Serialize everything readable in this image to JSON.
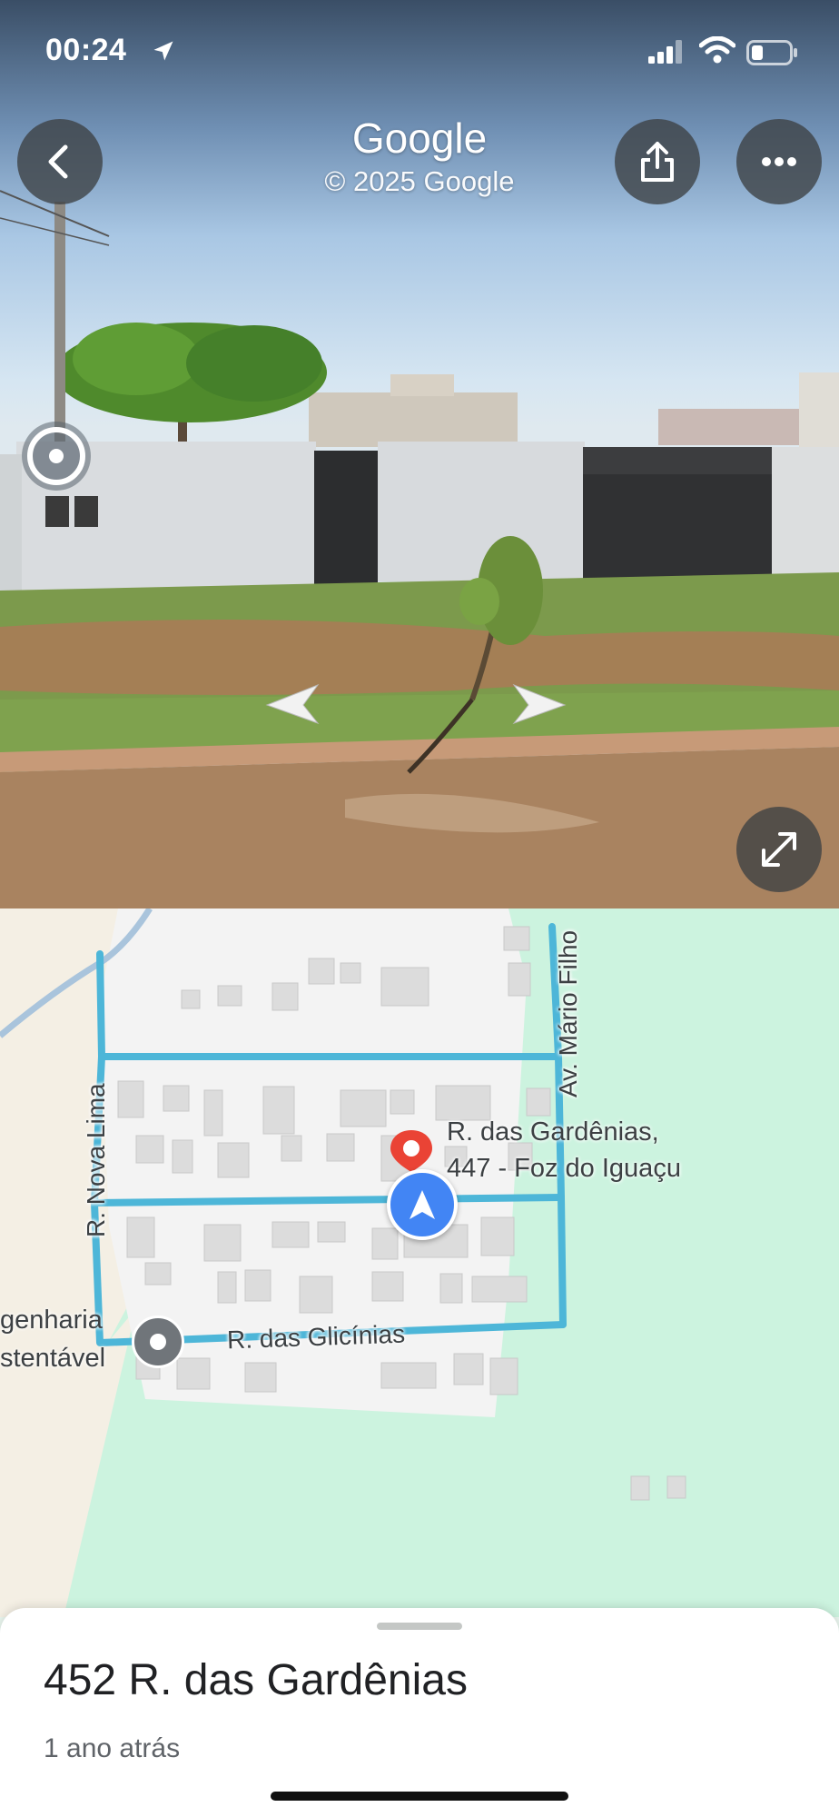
{
  "status_bar": {
    "time": "00:24"
  },
  "panorama": {
    "brand": "Google",
    "copyright": "© 2025 Google",
    "back_icon": "chevron-left-icon",
    "share_icon": "share-icon",
    "more_icon": "more-horizontal-icon",
    "expand_icon": "expand-diagonal-icon"
  },
  "map": {
    "streets": {
      "nova_lima": "R. Nova Lima",
      "mario_filho": "Av. Mário Filho",
      "glicinias": "R. das Glicínias"
    },
    "place": {
      "line1": "R. das Gardênias,",
      "line2": "447 - Foz do Iguaçu"
    },
    "poi": {
      "line1": "genharia",
      "line2": "stentável"
    },
    "colors": {
      "coverage": "#4db6d8",
      "park": "#ccf3df",
      "pin": "#ea4335",
      "nav": "#4285f4"
    }
  },
  "sheet": {
    "title": "452 R. das Gardênias",
    "subtitle": "1 ano atrás"
  }
}
